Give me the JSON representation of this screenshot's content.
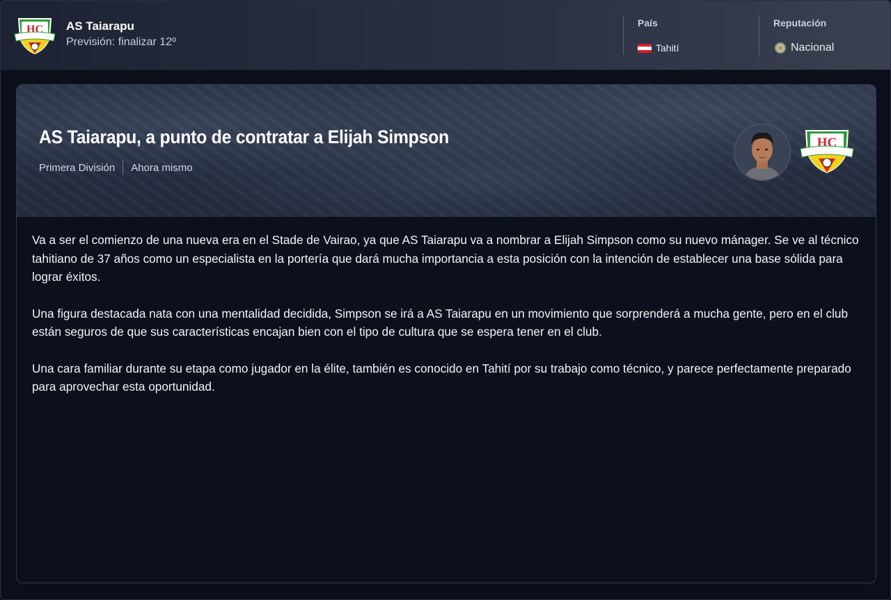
{
  "header": {
    "club_name": "AS Taiarapu",
    "forecast": "Previsión: finalizar 12º",
    "country_label": "País",
    "country_value": "Tahití",
    "reputation_label": "Reputación",
    "reputation_value": "Nacional"
  },
  "article": {
    "headline": "AS Taiarapu, a punto de contratar a Elijah Simpson",
    "competition": "Primera División",
    "time": "Ahora mismo",
    "paragraphs": [
      "Va a ser el comienzo de una nueva era en el Stade de Vairao, ya que AS Taiarapu va a nombrar a Elijah Simpson como su nuevo mánager. Se ve al técnico tahitiano de 37 años como un especialista en la portería que dará mucha importancia a esta posición con la intención de establecer una base sólida para lograr éxitos.",
      "Una figura destacada nata con una mentalidad decidida, Simpson se irá a AS Taiarapu en un movimiento que sorprenderá a mucha gente, pero en el club están seguros de que sus características encajan bien con el tipo de cultura que se espera tener en el club.",
      "Una cara familiar durante su etapa como jugador en la élite, también es conocido en Tahití por su trabajo como técnico, y parece perfectamente preparado para aprovechar esta oportunidad."
    ]
  },
  "icons": {
    "club_crest": "club-crest-icon",
    "flag": "tahiti-flag-icon",
    "reputation": "reputation-icon",
    "avatar": "manager-avatar"
  },
  "colors": {
    "crest_green": "#2f9a3a",
    "crest_yellow": "#f2d21b",
    "crest_red": "#d0232c",
    "background": "#0b0f1a"
  }
}
